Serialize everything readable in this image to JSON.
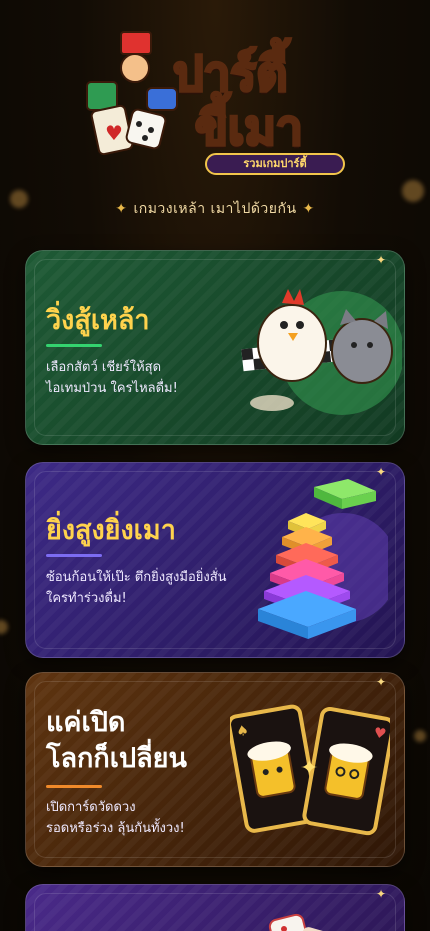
{
  "logo": {
    "title_line1": "ปาร์ตี้",
    "title_line2": "ขี้เมา",
    "badge": "รวมเกมปาร์ตี้"
  },
  "tagline": "เกมวงเหล้า เมาไปด้วยกัน",
  "cards": [
    {
      "title": "วิ่งสู้เหล้า",
      "desc_line1": "เลือกสัตว์ เชียร์ให้สุด",
      "desc_line2": "ไอเทมป่วน ใครไหลดื่ม!",
      "accent": "#34d36f"
    },
    {
      "title": "ยิ่งสูงยิ่งเมา",
      "desc_line1": "ซ้อนก้อนให้เป๊ะ ตึกยิ่งสูงมือยิ่งสั่น",
      "desc_line2": "ใครทำร่วงดื่ม!",
      "accent": "#7c6cf2"
    },
    {
      "title_line1": "แค่เปิด",
      "title_line2": "โลกก็เปลี่ยน",
      "desc_line1": "เปิดการ์ดวัดดวง",
      "desc_line2": "รอดหรือร่วง ลุ้นกันทั้งวง!",
      "accent": "#f08a2a"
    }
  ],
  "colors": {
    "gold": "#ffd34d",
    "bg": "#120c05"
  }
}
